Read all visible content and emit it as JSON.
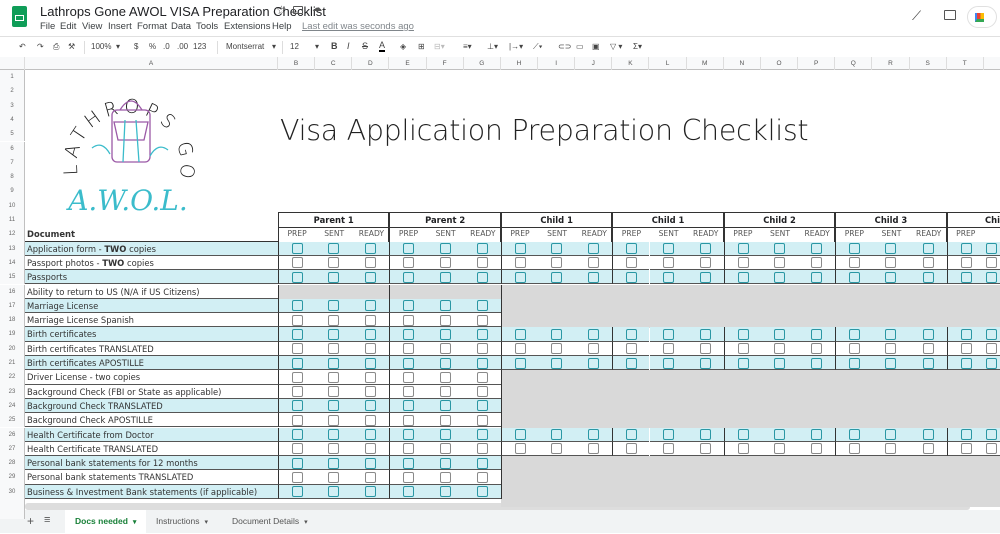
{
  "app": {
    "title": "Lathrops Gone AWOL VISA Preparation Checklist",
    "menus": [
      "File",
      "Edit",
      "View",
      "Insert",
      "Format",
      "Data",
      "Tools",
      "Extensions",
      "Help"
    ],
    "last_edit": "Last edit was seconds ago"
  },
  "toolbar": {
    "zoom": "100%",
    "currency": "$",
    "percent": "%",
    "dec_less": ".0",
    "dec_more": ".00",
    "format": "123",
    "font": "Montserrat",
    "size": "12",
    "bold": "B",
    "italic": "I",
    "strike": "S",
    "color": "A"
  },
  "columns": [
    "A",
    "B",
    "C",
    "D",
    "E",
    "F",
    "G",
    "H",
    "I",
    "J",
    "K",
    "L",
    "M",
    "N",
    "O",
    "P",
    "Q",
    "R",
    "S",
    "T"
  ],
  "logo": {
    "top": "LATHROPS GONE",
    "bottom": "A.W.O.L."
  },
  "sheet_title": "Visa Application Preparation Checklist",
  "groups": [
    "Parent 1",
    "Parent 2",
    "Child 1",
    "Child 1",
    "Child 2",
    "Child 3",
    "Chi"
  ],
  "subheaders": [
    "PREP",
    "SENT",
    "READY"
  ],
  "doc_header": "Document",
  "rows": [
    {
      "n": 13,
      "pre": "Application form - ",
      "bold": "TWO",
      "post": " copies",
      "scope": "all",
      "hl": true
    },
    {
      "n": 14,
      "pre": "Passport photos - ",
      "bold": "TWO",
      "post": " copies",
      "scope": "all",
      "hl": false
    },
    {
      "n": 15,
      "pre": "Passports",
      "scope": "all",
      "hl": true
    },
    {
      "n": 16,
      "pre": "Ability to return to US (N/A if US Citizens)",
      "scope": "none",
      "hl": false
    },
    {
      "n": 17,
      "pre": "Marriage License",
      "scope": "parents",
      "hl": true
    },
    {
      "n": 18,
      "pre": "Marriage License Spanish",
      "scope": "parents",
      "hl": false
    },
    {
      "n": 19,
      "pre": "Birth certificates",
      "scope": "all",
      "hl": true
    },
    {
      "n": 20,
      "pre": "Birth certificates TRANSLATED",
      "scope": "all",
      "hl": false
    },
    {
      "n": 21,
      "pre": "Birth certificates APOSTILLE",
      "scope": "all",
      "hl": true
    },
    {
      "n": 22,
      "pre": "Driver License - two copies",
      "scope": "parents",
      "hl": false
    },
    {
      "n": 23,
      "pre": "Background Check (FBI or State as applicable)",
      "scope": "parents",
      "hl": false
    },
    {
      "n": 24,
      "pre": "Background Check TRANSLATED",
      "scope": "parents",
      "hl": true
    },
    {
      "n": 25,
      "pre": "Background Check APOSTILLE",
      "scope": "parents",
      "hl": false
    },
    {
      "n": 26,
      "pre": "Health Certificate from Doctor",
      "scope": "all",
      "hl": true
    },
    {
      "n": 27,
      "pre": "Health Certificate TRANSLATED",
      "scope": "all",
      "hl": false
    },
    {
      "n": 28,
      "pre": "Personal bank statements for 12 months",
      "scope": "parents",
      "hl": true
    },
    {
      "n": 29,
      "pre": "Personal bank statements TRANSLATED",
      "scope": "parents",
      "hl": false
    },
    {
      "n": 30,
      "pre": "Business & Investment Bank statements (if applicable)",
      "scope": "parents",
      "hl": true
    }
  ],
  "tabs": {
    "add": "+",
    "list": "≡",
    "items": [
      "Docs needed",
      "Instructions",
      "Document Details"
    ],
    "active": 0
  },
  "colors": {
    "teal_row": "#d2eff4",
    "teal_box": "#2a97a4",
    "gray": "#d9d9d9",
    "tab_active": "#188038"
  }
}
